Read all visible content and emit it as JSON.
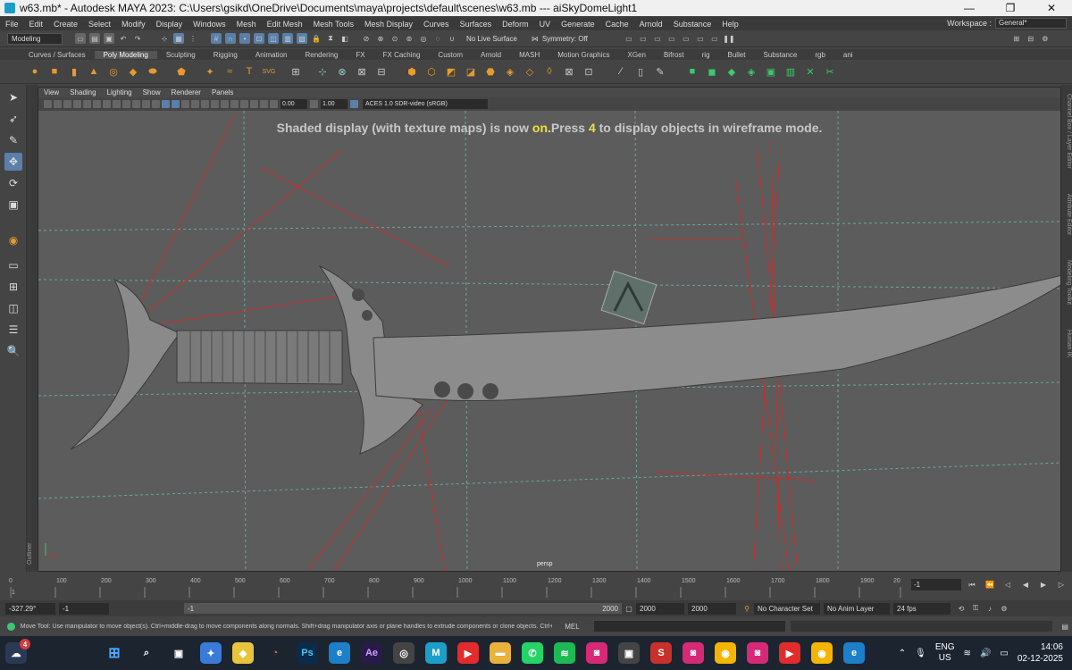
{
  "window": {
    "title": "w63.mb* - Autodesk MAYA 2023: C:\\Users\\gsikd\\OneDrive\\Documents\\maya\\projects\\default\\scenes\\w63.mb   ---   aiSkyDomeLight1",
    "minimize": "—",
    "maximize": "❐",
    "close": "✕"
  },
  "menu": {
    "items": [
      "File",
      "Edit",
      "Create",
      "Select",
      "Modify",
      "Display",
      "Windows",
      "Mesh",
      "Edit Mesh",
      "Mesh Tools",
      "Mesh Display",
      "Curves",
      "Surfaces",
      "Deform",
      "UV",
      "Generate",
      "Cache",
      "Arnold",
      "Substance",
      "Help"
    ],
    "workspace_label": "Workspace :",
    "workspace_value": "General*"
  },
  "status_line": {
    "mode": "Modeling",
    "live_surface": "No Live Surface",
    "symmetry": "Symmetry: Off"
  },
  "shelf": {
    "tabs": [
      "Curves / Surfaces",
      "Poly Modeling",
      "Sculpting",
      "Rigging",
      "Animation",
      "Rendering",
      "FX",
      "FX Caching",
      "Custom",
      "Arnold",
      "MASH",
      "Motion Graphics",
      "XGen",
      "Bifrost",
      "rig",
      "Bullet",
      "Substance",
      "rgb",
      "ani"
    ],
    "active_tab": "Poly Modeling"
  },
  "panel": {
    "menus": [
      "View",
      "Shading",
      "Lighting",
      "Show",
      "Renderer",
      "Panels"
    ],
    "exposure": "0.00",
    "gamma": "1.00",
    "color_space": "ACES 1.0 SDR-video (sRGB)",
    "camera": "persp"
  },
  "hud": {
    "part1": "Shaded display (with texture maps) is now ",
    "highlight_on": "on.",
    "part2": "Press ",
    "highlight_key": "4",
    "part3": " to display objects in wireframe mode."
  },
  "side_labels": {
    "outliner": "Outliner",
    "right": [
      "Channel Box / Layer Editor",
      "Attribute Editor",
      "Modeling Toolkit",
      "Human IK"
    ]
  },
  "timeline": {
    "ticks": [
      "0",
      "100",
      "200",
      "300",
      "400",
      "500",
      "600",
      "700",
      "800",
      "900",
      "1000",
      "1100",
      "1200",
      "1300",
      "1400",
      "1500",
      "1600",
      "1700",
      "1800",
      "1900",
      "20"
    ],
    "current_frame": "1",
    "current_frame_field": "-1"
  },
  "range": {
    "cursor_coord": "-327.29°",
    "start": "-1",
    "slider_start": "-1",
    "slider_end": "2000",
    "end": "2000",
    "end2": "2000",
    "character_set": "No Character Set",
    "anim_layer": "No Anim Layer",
    "fps": "24 fps"
  },
  "help": {
    "text": "Move Tool: Use manipulator to move object(s). Ctrl+middle-drag to move components along normals. Shift+drag manipulator axis or plane handles to extrude components or clone objects. Ctrl+Shift+drag to con",
    "mel": "MEL"
  },
  "taskbar": {
    "badge_left": "4",
    "ps": "Ps",
    "ae": "Ae",
    "lang": "ENG",
    "region": "US",
    "time": "14:06",
    "date": "02-12-2025"
  }
}
